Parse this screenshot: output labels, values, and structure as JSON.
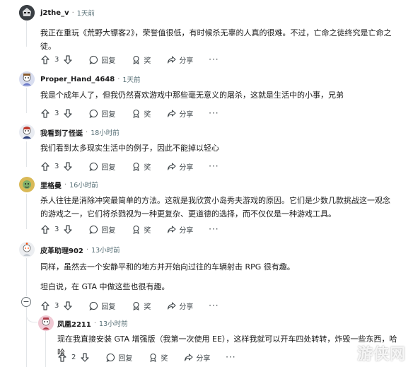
{
  "labels": {
    "reply": "回复",
    "award": "奖",
    "share": "分享"
  },
  "comments": [
    {
      "user": "j2the_v",
      "time": "1天前",
      "text": "我正在重玩《荒野大镖客2》，荣誉值很低，有时候杀无辜的人真的很难。不过，亡命之徒终究是亡命之徒。",
      "score": "3"
    },
    {
      "user": "Proper_Hand_4648",
      "time": "1天前",
      "text": "我是个成年人了，但我仍然喜欢游戏中那些毫无意义的屠杀，这就是生活中的小事，兄弟",
      "score": "3"
    },
    {
      "user": "我看到了怪诞",
      "time": "18小时前",
      "text": "我们看到太多现实生活中的例子，因此不能掉以轻心",
      "score": "3"
    },
    {
      "user": "里格曼",
      "time": "16小时前",
      "text": "杀人往往是消除冲突最简单的方法。这就是我欣赏小岛秀夫游戏的原因。它们是少数几款挑战这一观念的游戏之一，它们将杀戮视为一种更复杂、更道德的选择，而不仅仅是一种游戏工具。",
      "score": "3"
    },
    {
      "user": "皮革助理902",
      "time": "13小时前",
      "text": "同样，虽然去一个安静平和的地方并开始向过往的车辆射击 RPG 很有趣。",
      "text2": "坦白说，在 GTA 中做这些也很有趣。",
      "score": "3"
    },
    {
      "user": "凤凰2211",
      "time": "13小时前",
      "text": "现在我直接安装 GTA 增强版（我第一次使用 EE），这样我就可以开车四处转转，炸毁一些东西，哈哈",
      "score": "2"
    }
  ],
  "watermark": "游侠网",
  "colors": {
    "text": "#1c1c1c",
    "meta": "#576f76",
    "thread": "#e2e5e8"
  }
}
